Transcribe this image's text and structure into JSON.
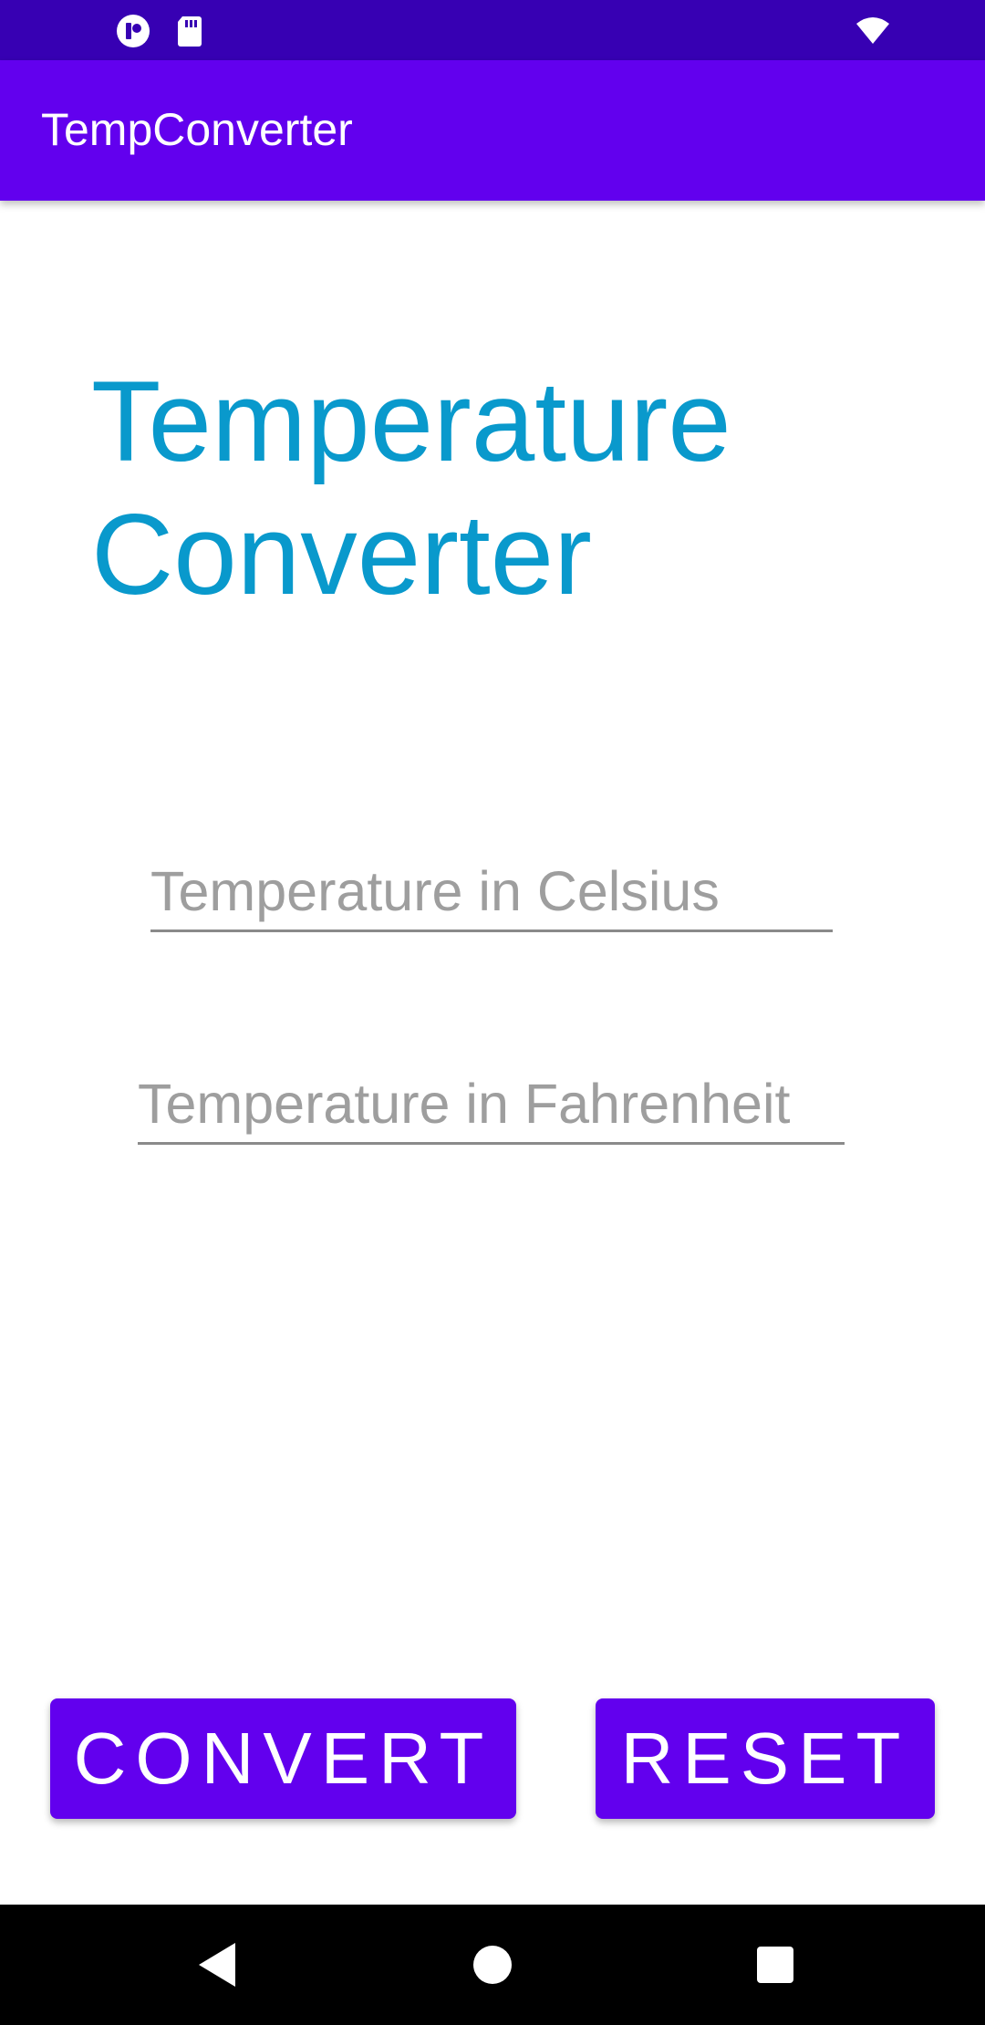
{
  "status_bar": {
    "left_icons": [
      "notification-icon",
      "sd-card-icon"
    ],
    "right_icons": [
      "wifi-icon"
    ]
  },
  "app_bar": {
    "title": "TempConverter"
  },
  "heading": {
    "line1": "Temperature",
    "line2": "Converter"
  },
  "inputs": {
    "celsius": {
      "value": "",
      "placeholder": "Temperature in Celsius"
    },
    "fahrenheit": {
      "value": "",
      "placeholder": "Temperature in Fahrenheit"
    }
  },
  "buttons": {
    "convert_label": "CONVERT",
    "reset_label": "RESET"
  },
  "nav_bar": {
    "icons": [
      "back-icon",
      "home-icon",
      "recents-icon"
    ]
  },
  "colors": {
    "status_bar": "#3700b3",
    "primary": "#6200ee",
    "heading_text": "#0999cc",
    "placeholder": "#9e9e9e",
    "underline": "#8a8a8a",
    "nav_bar": "#000000"
  }
}
